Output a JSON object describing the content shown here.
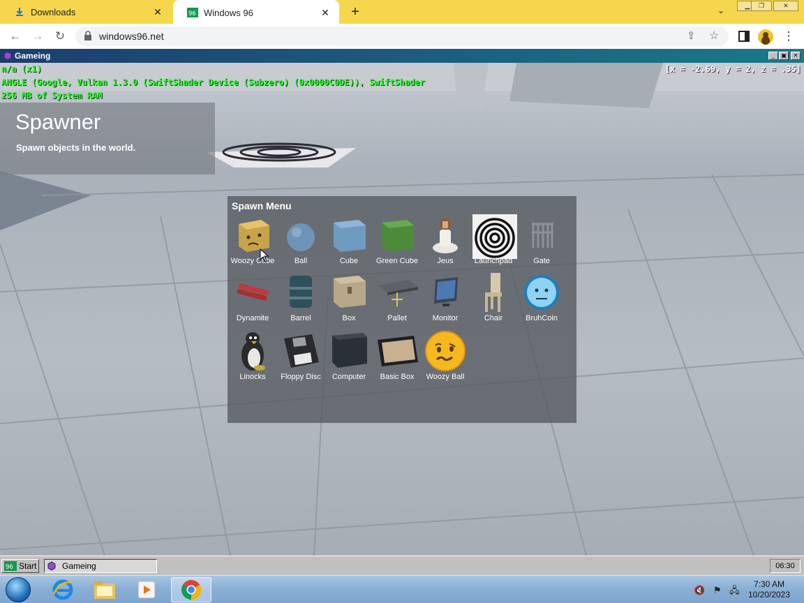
{
  "browser": {
    "tabs": [
      {
        "title": "Downloads",
        "icon": "download-icon",
        "active": false
      },
      {
        "title": "Windows 96",
        "icon": "windows96-icon",
        "active": true
      }
    ],
    "url": "windows96.net"
  },
  "game_window": {
    "title": "Gameing",
    "hud": {
      "line1": "n/a (x1)",
      "line2": "ANGLE (Google, Vulkan 1.3.0 (SwiftShader Device (Subzero) (0x0000C0DE)), SwiftShader",
      "line3": "256 MB of System RAM",
      "coords": "[x = -2.69, y = 2, z = .35]"
    },
    "spawner": {
      "title": "Spawner",
      "description": "Spawn objects in the world."
    },
    "spawn_menu": {
      "title": "Spawn Menu",
      "items": [
        {
          "label": "Woozy Cube",
          "icon": "woozy-cube-icon"
        },
        {
          "label": "Ball",
          "icon": "ball-icon"
        },
        {
          "label": "Cube",
          "icon": "cube-icon"
        },
        {
          "label": "Green Cube",
          "icon": "green-cube-icon"
        },
        {
          "label": "Jeus",
          "icon": "jeus-icon"
        },
        {
          "label": "Launchpad",
          "icon": "launchpad-icon"
        },
        {
          "label": "Gate",
          "icon": "gate-icon"
        },
        {
          "label": "Dynamite",
          "icon": "dynamite-icon"
        },
        {
          "label": "Barrel",
          "icon": "barrel-icon"
        },
        {
          "label": "Box",
          "icon": "box-icon"
        },
        {
          "label": "Pallet",
          "icon": "pallet-icon"
        },
        {
          "label": "Monitor",
          "icon": "monitor-icon"
        },
        {
          "label": "Chair",
          "icon": "chair-icon"
        },
        {
          "label": "BruhCoin",
          "icon": "bruhcoin-icon"
        },
        {
          "label": "Linocks",
          "icon": "linocks-icon"
        },
        {
          "label": "Floppy Disc",
          "icon": "floppy-disc-icon"
        },
        {
          "label": "Computer",
          "icon": "computer-icon"
        },
        {
          "label": "Basic Box",
          "icon": "basic-box-icon"
        },
        {
          "label": "Woozy Ball",
          "icon": "woozy-ball-icon"
        }
      ]
    }
  },
  "w96_taskbar": {
    "start_label": "Start",
    "task_label": "Gameing",
    "clock": "06:30"
  },
  "w7_taskbar": {
    "time": "7:30 AM",
    "date": "10/20/2023"
  },
  "colors": {
    "chrome_frame": "#f6d64d",
    "hud_green": "#29ff29",
    "w96_title_start": "#1d3d6e",
    "w96_title_end": "#1a7a8c"
  }
}
